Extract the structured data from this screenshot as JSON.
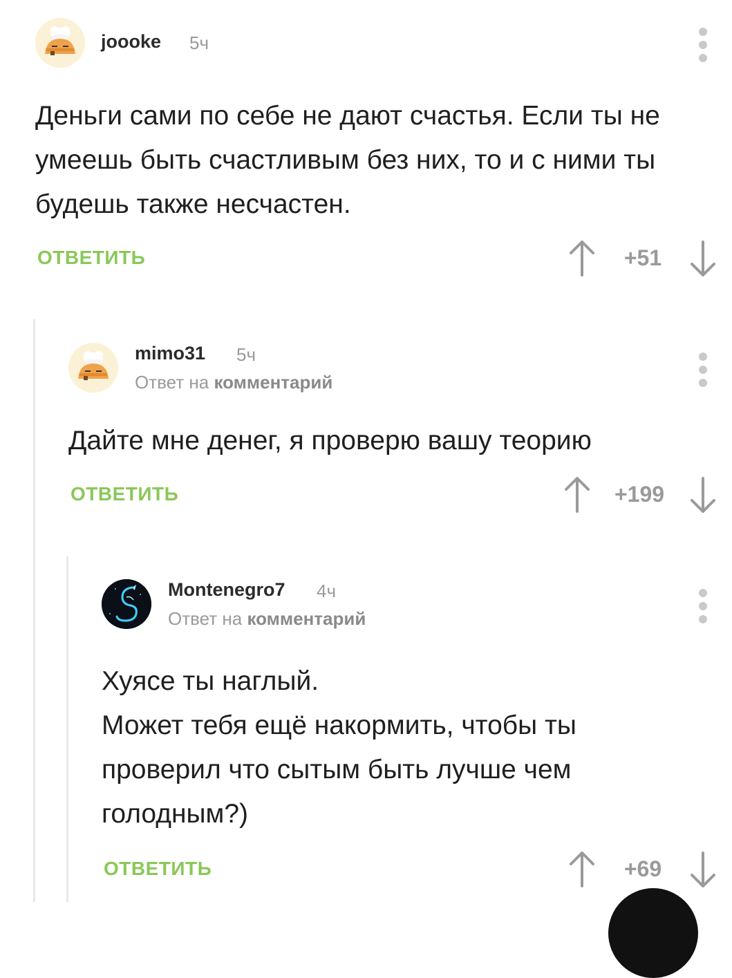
{
  "comments": [
    {
      "username": "joooke",
      "time": "5ч",
      "reply_to": null,
      "body_lines": [
        "Деньги сами по себе не дают счастья. Если ты не",
        "умеешь быть счастливым без них, то и с ними ты",
        "будешь также несчастен."
      ],
      "reply_label": "ОТВЕТИТЬ",
      "score": "+51"
    },
    {
      "username": "mimo31",
      "time": "5ч",
      "reply_to": {
        "prefix": "Ответ на",
        "target": "комментарий"
      },
      "body_lines": [
        "Дайте мне денег, я проверю вашу теорию"
      ],
      "reply_label": "ОТВЕТИТЬ",
      "score": "+199"
    },
    {
      "username": "Montenegro7",
      "time": "4ч",
      "reply_to": {
        "prefix": "Ответ на",
        "target": "комментарий"
      },
      "body_lines": [
        "Хуясе ты наглый.",
        "Может тебя ещё накормить, чтобы ты",
        "проверил что сытым быть лучше чем",
        "голодным?)"
      ],
      "reply_label": "ОТВЕТИТЬ",
      "score": "+69"
    }
  ],
  "colors": {
    "accent_green": "#8ac858",
    "muted_gray": "#9a9a9a",
    "thread_line": "#e8e8e8"
  },
  "icons": [
    "chef-avatar-icon",
    "dragon-avatar-icon",
    "more-vertical-icon",
    "arrow-up-icon",
    "arrow-down-icon"
  ]
}
